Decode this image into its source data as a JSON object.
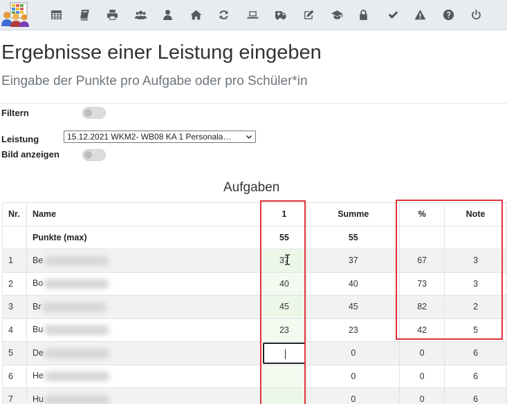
{
  "toolbar": {
    "icons": [
      "table-icon",
      "book-icon",
      "print-icon",
      "group-icon",
      "user-icon",
      "home-icon",
      "refresh-icon",
      "laptop-icon",
      "ambulance-icon",
      "edit-icon",
      "graduation-cap-icon",
      "lock-icon",
      "check-icon",
      "warning-icon",
      "help-icon",
      "power-icon"
    ]
  },
  "page": {
    "title": "Ergebnisse einer Leistung eingeben",
    "subtitle": "Eingabe der Punkte pro Aufgabe oder pro Schüler*in"
  },
  "filters": {
    "filter_label": "Filtern",
    "leistung_label": "Leistung",
    "leistung_value": "15.12.2021 WKM2- WB08 KA 1 Personala…",
    "bild_label": "Bild anzeigen"
  },
  "table": {
    "group_label": "Aufgaben",
    "headers": {
      "nr": "Nr.",
      "name": "Name",
      "a1": "1",
      "summe": "Summe",
      "pct": "%",
      "note": "Note"
    },
    "max_row": {
      "label": "Punkte (max)",
      "a1": "55",
      "summe": "55"
    },
    "rows": [
      {
        "nr": "1",
        "name": "Be",
        "a1": "37",
        "summe": "37",
        "pct": "67",
        "note": "3"
      },
      {
        "nr": "2",
        "name": "Bo",
        "a1": "40",
        "summe": "40",
        "pct": "73",
        "note": "3"
      },
      {
        "nr": "3",
        "name": "Br",
        "a1": "45",
        "summe": "45",
        "pct": "82",
        "note": "2"
      },
      {
        "nr": "4",
        "name": "Bu",
        "a1": "23",
        "summe": "23",
        "pct": "42",
        "note": "5"
      },
      {
        "nr": "5",
        "name": "De",
        "a1": "",
        "summe": "0",
        "pct": "0",
        "note": "6"
      },
      {
        "nr": "6",
        "name": "He",
        "a1": "",
        "summe": "0",
        "pct": "0",
        "note": "6"
      },
      {
        "nr": "7",
        "name": "Hu",
        "a1": "",
        "summe": "0",
        "pct": "0",
        "note": "6"
      }
    ]
  },
  "colors": {
    "highlight": "#e0313a",
    "toolbar_bg": "#e9ecef",
    "task_col_bg": "#f3fbf0"
  }
}
